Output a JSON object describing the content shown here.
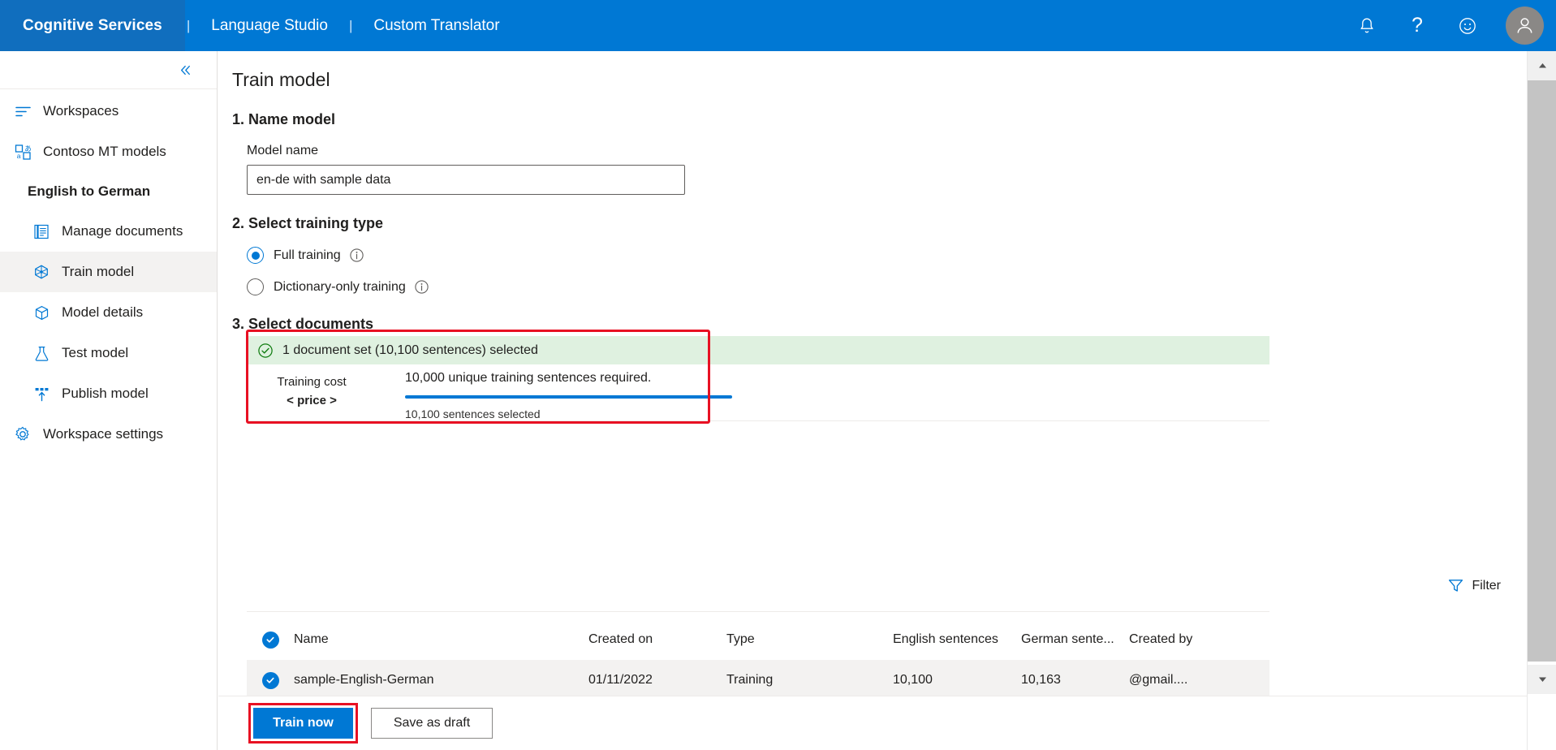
{
  "topbar": {
    "brand": "Cognitive Services",
    "separator": "|",
    "links": [
      {
        "label": "Language Studio"
      },
      {
        "label": "Custom Translator"
      }
    ],
    "icons": [
      {
        "name": "bell-icon"
      },
      {
        "name": "help-icon",
        "glyph": "?"
      },
      {
        "name": "feedback-smiley-icon"
      }
    ],
    "avatar": {
      "name": "user-avatar"
    },
    "accent_color": "#0078d4",
    "brand_cell_color": "#106ebe"
  },
  "sidebar": {
    "collapse_label": "«",
    "items": [
      {
        "label": "Workspaces",
        "icon": "workspaces-icon",
        "level": "top",
        "selected": false
      },
      {
        "label": "Contoso MT models",
        "icon": "translate-models-icon",
        "level": "top",
        "selected": false
      },
      {
        "label": "English to German",
        "icon": "",
        "level": "group",
        "selected": false
      },
      {
        "label": "Manage documents",
        "icon": "documents-icon",
        "level": "child",
        "selected": false
      },
      {
        "label": "Train model",
        "icon": "train-model-icon",
        "level": "child",
        "selected": true
      },
      {
        "label": "Model details",
        "icon": "model-details-icon",
        "level": "child",
        "selected": false
      },
      {
        "label": "Test model",
        "icon": "flask-icon",
        "level": "child",
        "selected": false
      },
      {
        "label": "Publish model",
        "icon": "publish-icon",
        "level": "child",
        "selected": false
      },
      {
        "label": "Workspace settings",
        "icon": "gear-icon",
        "level": "top",
        "selected": false
      }
    ]
  },
  "main": {
    "page_title": "Train model",
    "step1": {
      "heading": "1. Name model",
      "field_label": "Model name",
      "model_name_value": "en-de with sample data",
      "model_name_placeholder": "Model name"
    },
    "step2": {
      "heading": "2. Select training type",
      "options": [
        {
          "label": "Full training",
          "checked": true,
          "info": "i"
        },
        {
          "label": "Dictionary-only training",
          "checked": false,
          "info": "i"
        }
      ]
    },
    "step3": {
      "heading": "3. Select documents",
      "banner_text": "1 document set (10,100 sentences) selected",
      "banner_icon": "green-check-circle-icon",
      "banner_bg": "#dff1e0",
      "cost_label": "Training cost",
      "cost_value": "< price >",
      "required_text": "10,000 unique training sentences required.",
      "selected_text": "10,100 sentences selected",
      "progress_percent": 100,
      "highlight_color": "#e81123"
    },
    "filter": {
      "label": "Filter",
      "icon": "filter-funnel-icon"
    },
    "table": {
      "columns": [
        "Name",
        "Created on",
        "Type",
        "English sentences",
        "German sente...",
        "Created by"
      ],
      "rows": [
        {
          "selected": true,
          "name": "sample-English-German",
          "created_on": "01/11/2022",
          "type": "Training",
          "english_sentences": "10,100",
          "german_sentences": "10,163",
          "created_by": "@gmail...."
        }
      ]
    },
    "footer": {
      "primary_label": "Train now",
      "secondary_label": "Save as draft",
      "primary_highlight_color": "#e81123"
    }
  },
  "scrollbar": {
    "up": "▲",
    "down": "▼"
  }
}
